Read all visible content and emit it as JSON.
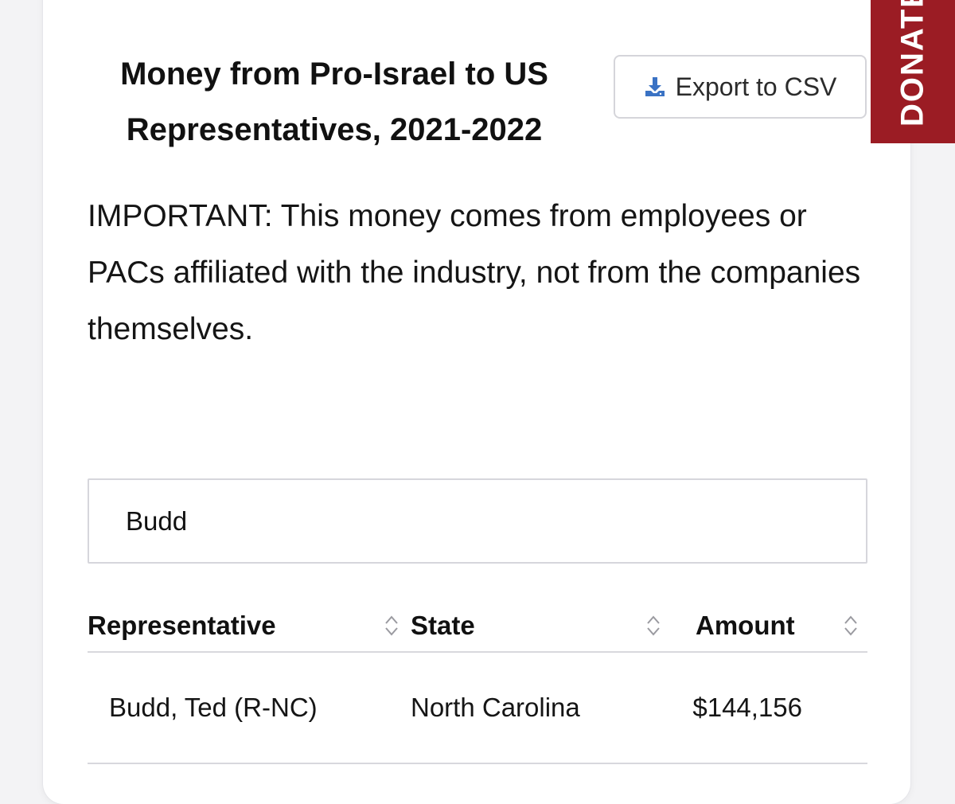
{
  "header": {
    "title": "Money from Pro-Israel to US Representatives, 2021-2022",
    "export_label": "Export to CSV",
    "export_icon": "download-icon",
    "donate_label": "DONATE"
  },
  "notice": {
    "text": "IMPORTANT: This money comes from employees or PACs affiliated with the industry, not from the companies themselves."
  },
  "search": {
    "value": "Budd"
  },
  "table": {
    "columns": [
      "Representative",
      "State",
      "Amount"
    ],
    "sort_icon": "sort-arrows-icon",
    "rows": [
      [
        "Budd, Ted (R-NC)",
        "North Carolina",
        "$144,156"
      ]
    ]
  },
  "colors": {
    "donate_bg": "#9b1c24",
    "icon_blue": "#3a72c4",
    "border": "#d6d6dc"
  }
}
